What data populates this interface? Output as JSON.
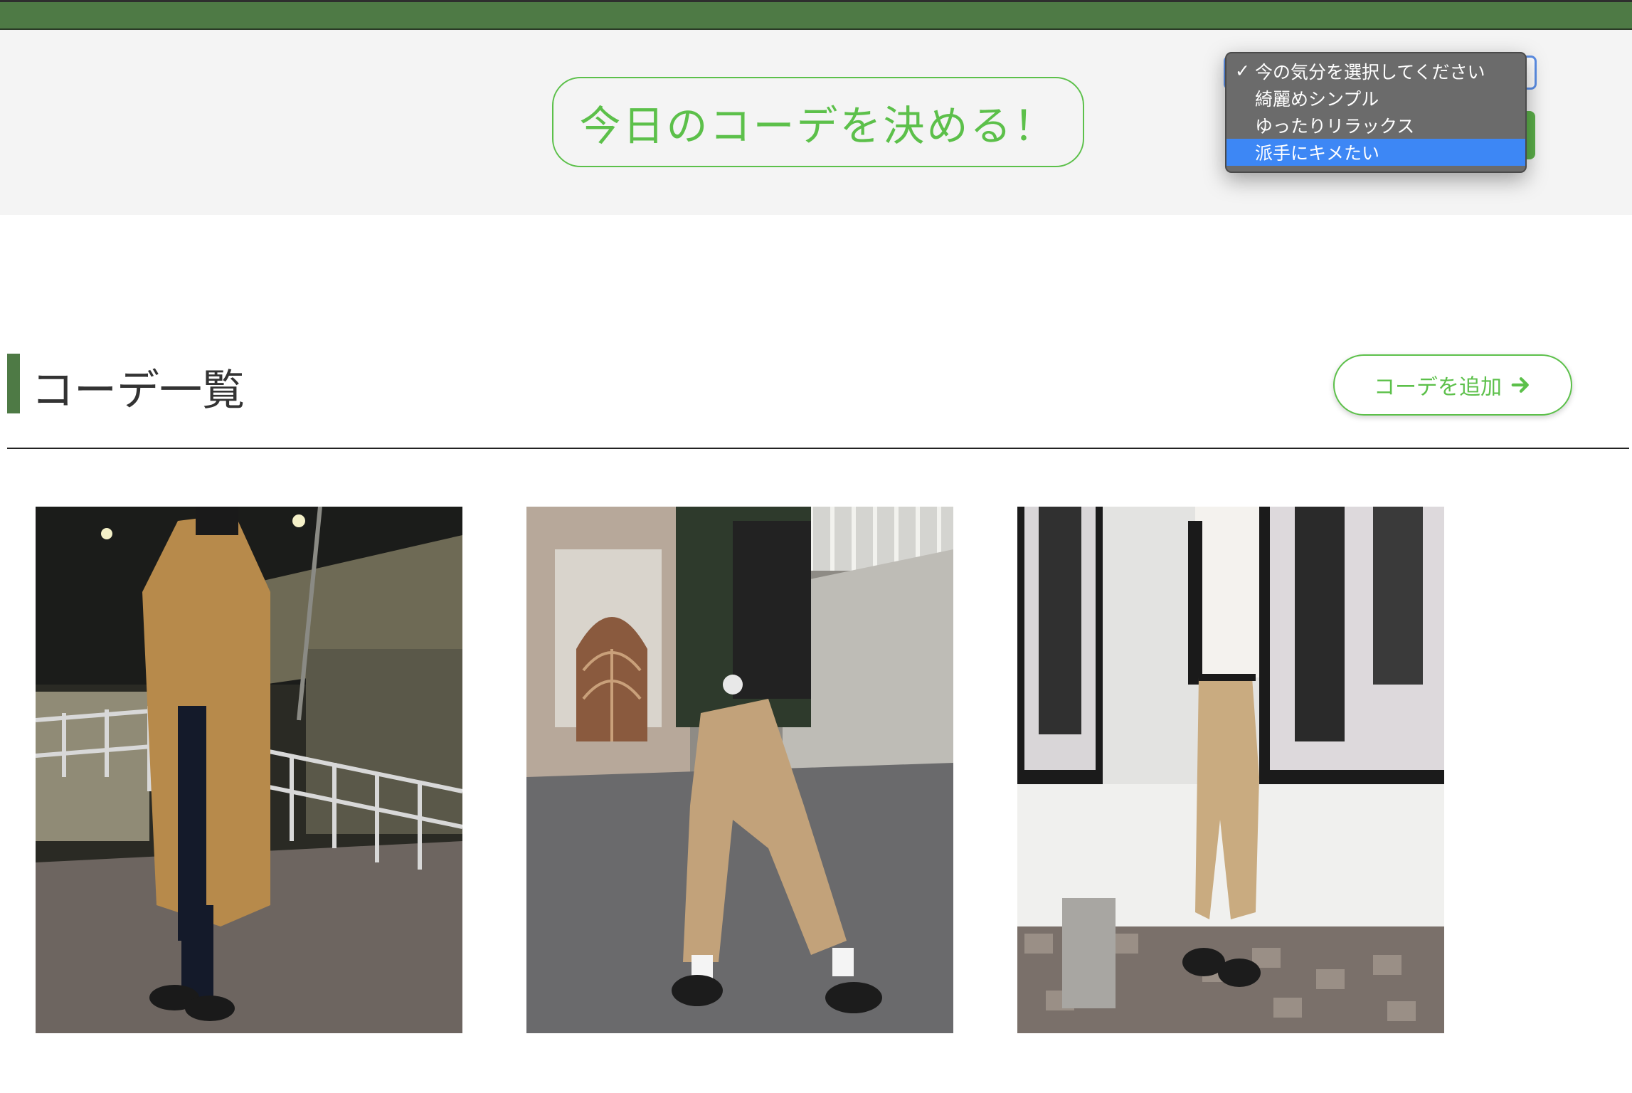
{
  "hero": {
    "decide_label": "今日のコーデを決める！"
  },
  "mood_select": {
    "options": [
      {
        "label": "今の気分を選択してください",
        "checked": true,
        "highlighted": false
      },
      {
        "label": "綺麗めシンプル",
        "checked": false,
        "highlighted": false
      },
      {
        "label": "ゆったりリラックス",
        "checked": false,
        "highlighted": false
      },
      {
        "label": "派手にキメたい",
        "checked": false,
        "highlighted": true
      }
    ],
    "check_mark": "✓"
  },
  "section": {
    "title": "コーデ一覧",
    "add_label": "コーデを追加"
  },
  "colors": {
    "header_green": "#4e7a45",
    "accent_green": "#5cc04a",
    "highlight_blue": "#3d87f5"
  },
  "coords": [
    {
      "scene": "night street, camel long coat"
    },
    {
      "scene": "daytime walk, beige pants"
    },
    {
      "scene": "shop window, white top and beige pants"
    }
  ]
}
